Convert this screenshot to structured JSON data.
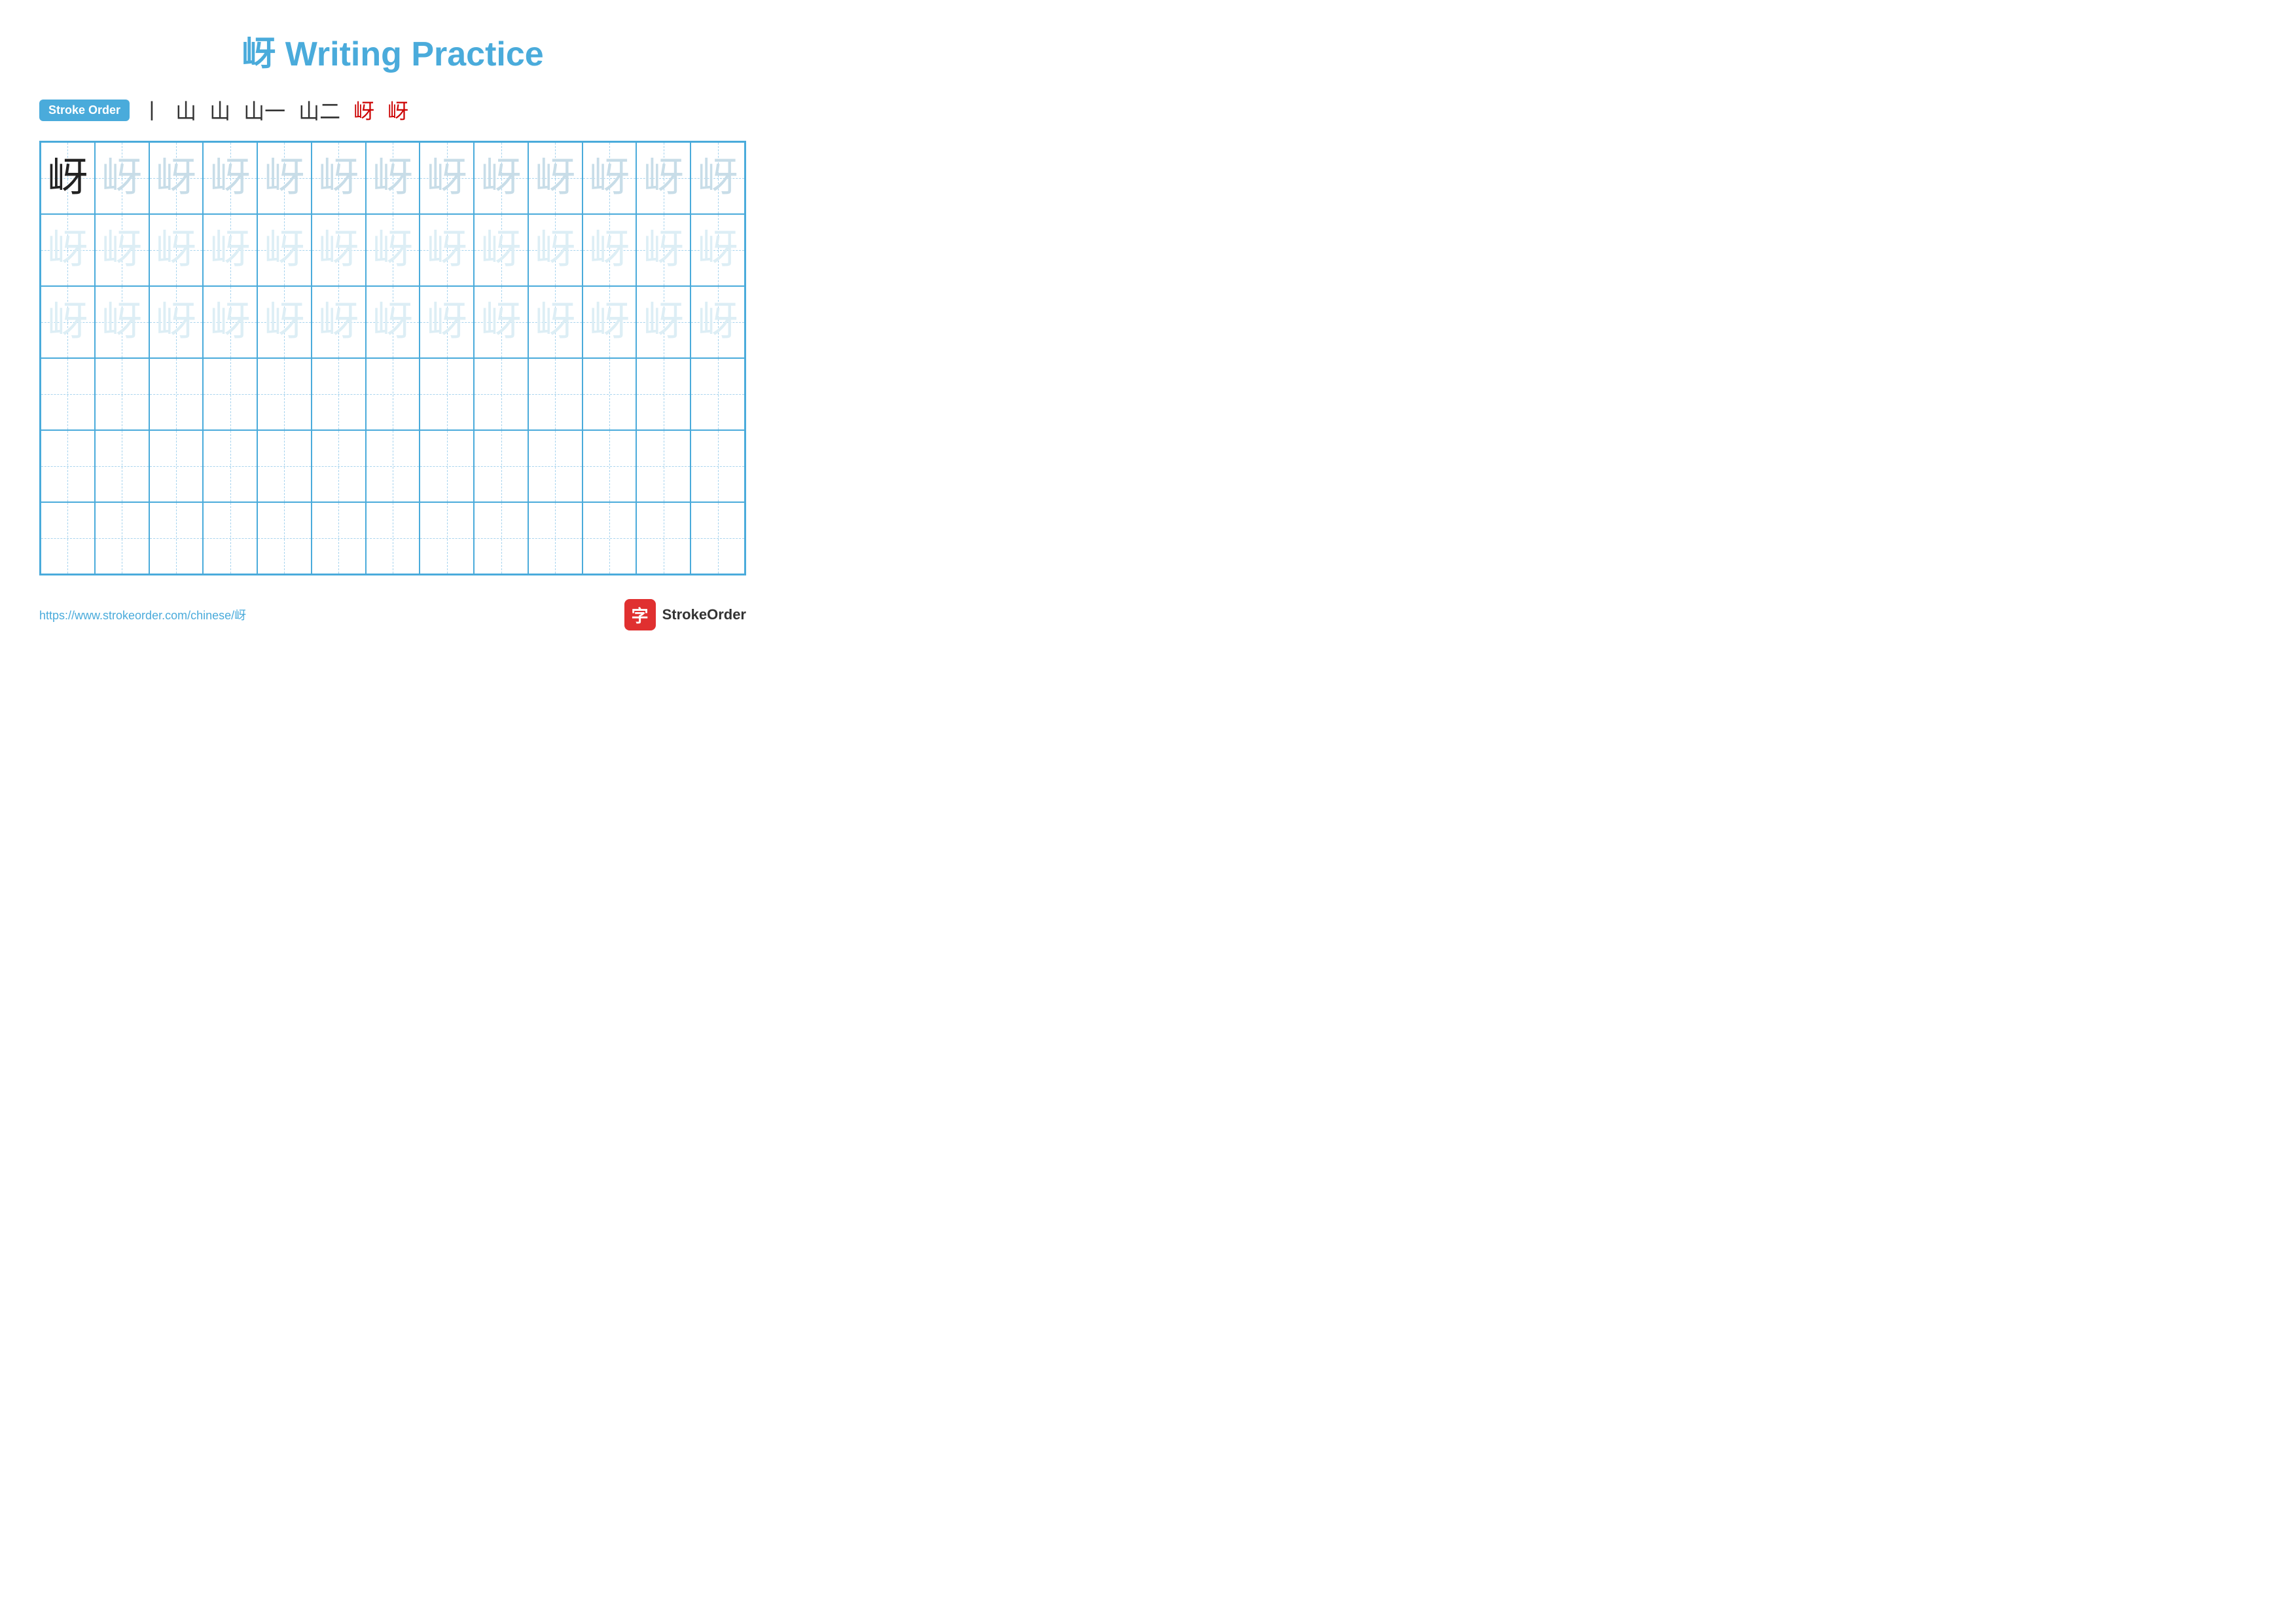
{
  "page": {
    "title": "岈 Writing Practice",
    "title_color": "#4aabdb"
  },
  "stroke_order": {
    "badge_label": "Stroke Order",
    "strokes": [
      "丨",
      "山",
      "山",
      "山一",
      "山二",
      "岈",
      "岈"
    ]
  },
  "grid": {
    "rows": 6,
    "cols": 13,
    "character": "岈",
    "row_styles": [
      "dark",
      "light",
      "light",
      "empty",
      "empty",
      "empty"
    ]
  },
  "footer": {
    "url": "https://www.strokeorder.com/chinese/岈",
    "logo_char": "字",
    "logo_text": "StrokeOrder"
  }
}
